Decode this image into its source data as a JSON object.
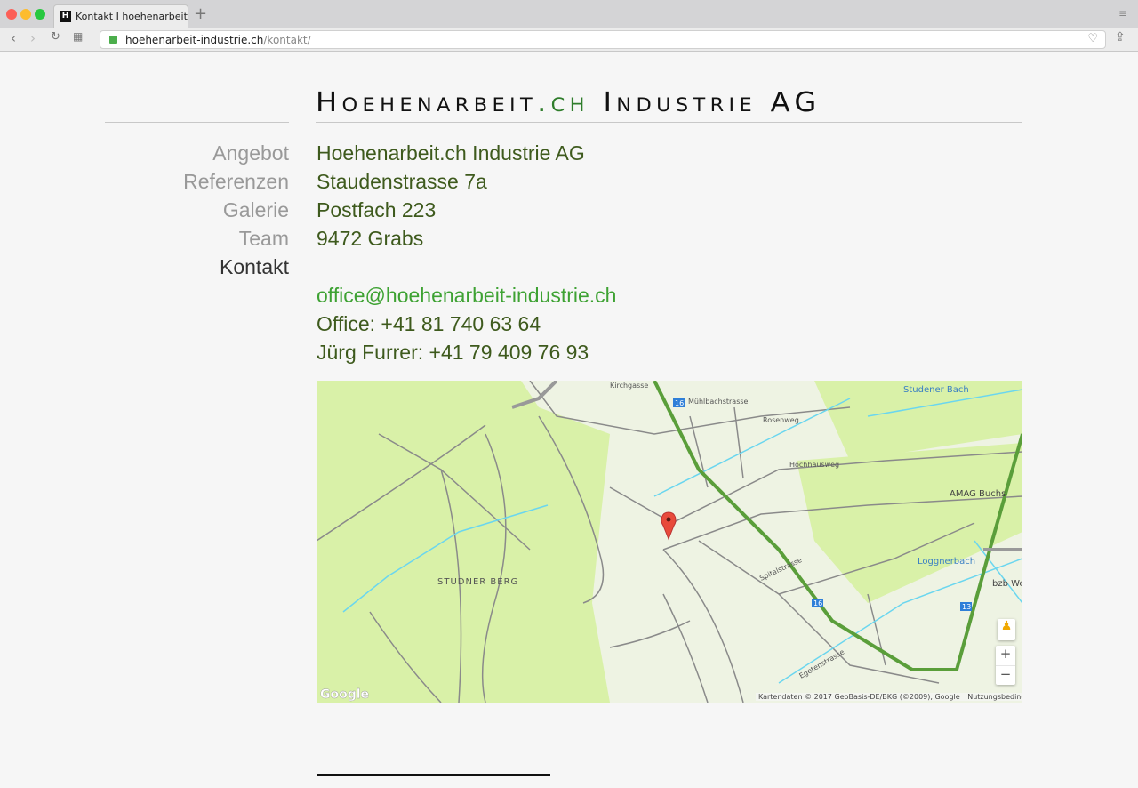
{
  "browser": {
    "tab_title": "Kontakt I hoehenarbeit-industrie",
    "favicon": "H",
    "url_domain": "hoehenarbeit-industrie.ch",
    "url_path": "/kontakt/"
  },
  "logo": {
    "part1": "Hoehenarbeit",
    "part2": ".ch",
    "part3": " Industrie AG"
  },
  "nav": [
    {
      "label": "Angebot"
    },
    {
      "label": "Referenzen"
    },
    {
      "label": "Galerie"
    },
    {
      "label": "Team"
    },
    {
      "label": "Kontakt",
      "active": true
    }
  ],
  "contact": {
    "company": "Hoehenarbeit.ch Industrie AG",
    "street": "Staudenstrasse 7a",
    "pobox": "Postfach 223",
    "city": "9472 Grabs",
    "email": "office@hoehenarbeit-industrie.ch",
    "office": "Office: +41 81 740 63 64",
    "mobile": "Jürg Furrer: +41 79 409 76 93"
  },
  "map": {
    "labels": {
      "studner_berg": "STUDNER BERG",
      "studener_bach": "Studener Bach",
      "amag": "AMAG Buchs",
      "loggnerbach": "Loggnerbach",
      "bzb": "bzb We",
      "rosenweg": "Rosenweg",
      "hochhausweg": "Hochhausweg",
      "kirchgasse": "Kirchgasse",
      "muehlbach": "Mühlbachstrasse",
      "spitalstrasse": "Spitalstrasse",
      "egetenstrasse": "Egetenstrasse"
    },
    "road_number": "16",
    "road_number2": "13",
    "google": "Google",
    "attribution": "Kartendaten © 2017 GeoBasis-DE/BKG (©2009), Google",
    "terms": "Nutzungsbedingungen",
    "zoom_in": "+",
    "zoom_out": "−"
  },
  "colors": {
    "accent": "#3ea233",
    "text": "#3e5a1d"
  }
}
